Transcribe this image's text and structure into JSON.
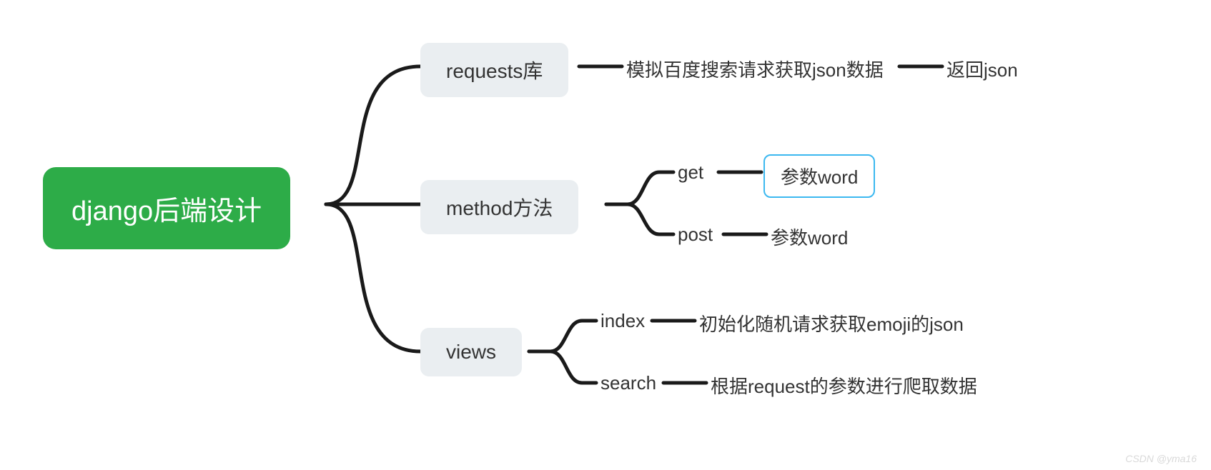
{
  "root": {
    "label": "django后端设计"
  },
  "branches": {
    "requests": {
      "label": "requests库",
      "children": [
        {
          "label": "模拟百度搜索请求获取json数据",
          "children": [
            {
              "label": "返回json"
            }
          ]
        }
      ]
    },
    "method": {
      "label": "method方法",
      "children": [
        {
          "label": "get",
          "children": [
            {
              "label": "参数word",
              "highlighted": true
            }
          ]
        },
        {
          "label": "post",
          "children": [
            {
              "label": "参数word"
            }
          ]
        }
      ]
    },
    "views": {
      "label": "views",
      "children": [
        {
          "label": "index",
          "children": [
            {
              "label": "初始化随机请求获取emoji的json"
            }
          ]
        },
        {
          "label": "search",
          "children": [
            {
              "label": "根据request的参数进行爬取数据"
            }
          ]
        }
      ]
    }
  },
  "watermark": "CSDN @yma16",
  "colors": {
    "root_bg": "#2dac48",
    "branch_bg": "#eaeef1",
    "highlight_border": "#3cb8f0",
    "stroke": "#1a1a1a"
  }
}
